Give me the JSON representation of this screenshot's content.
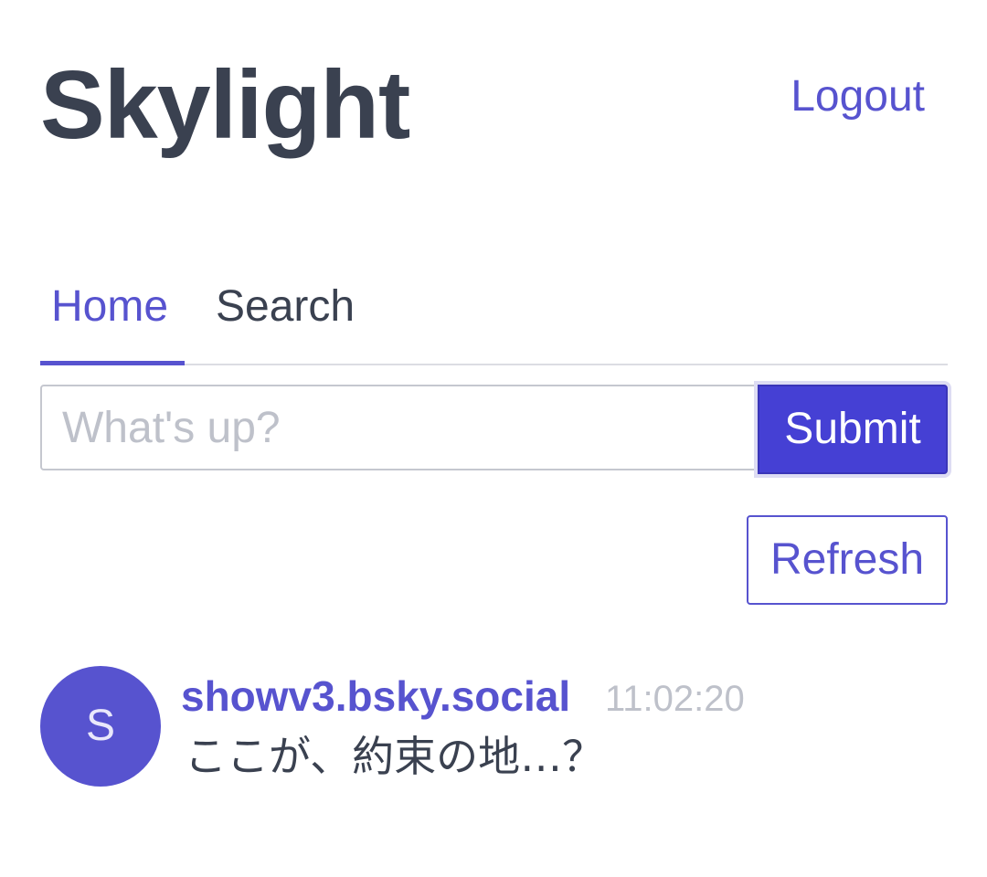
{
  "header": {
    "app_title": "Skylight",
    "logout_label": "Logout"
  },
  "tabs": [
    {
      "label": "Home",
      "active": true
    },
    {
      "label": "Search",
      "active": false
    }
  ],
  "composer": {
    "placeholder": "What's up?",
    "value": "",
    "submit_label": "Submit"
  },
  "refresh_label": "Refresh",
  "feed": [
    {
      "avatar_letter": "S",
      "handle": "showv3.bsky.social",
      "time": "11:02:20",
      "text": "ここが、約束の地…？"
    }
  ],
  "colors": {
    "accent": "#5753cf",
    "primary_button": "#4540d4",
    "text": "#3a4150",
    "muted": "#bec1ca"
  }
}
